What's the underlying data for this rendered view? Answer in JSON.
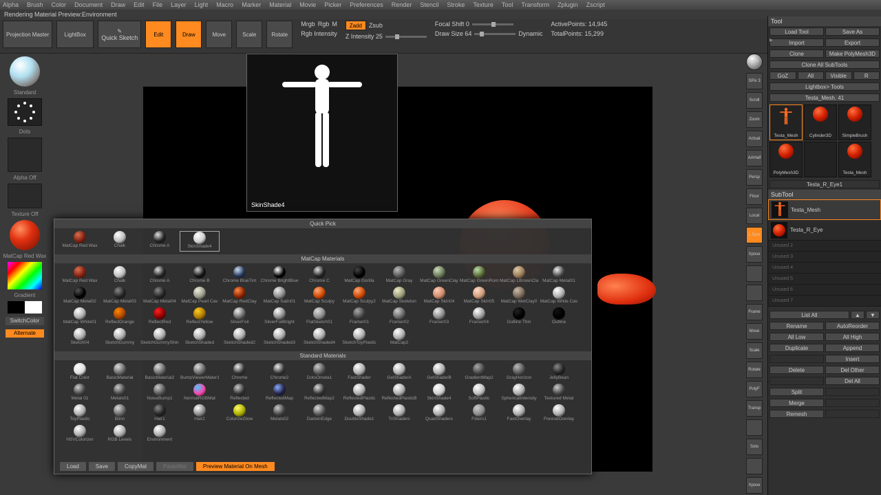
{
  "menu": [
    "Alpha",
    "Brush",
    "Color",
    "Document",
    "Draw",
    "Edit",
    "File",
    "Layer",
    "Light",
    "Macro",
    "Marker",
    "Material",
    "Movie",
    "Picker",
    "Preferences",
    "Render",
    "Stencil",
    "Stroke",
    "Texture",
    "Tool",
    "Transform",
    "Zplugin",
    "Zscript"
  ],
  "status": "Rendering Material Preview:Environment",
  "toolbar": {
    "projection": "Projection Master",
    "lightbox": "LightBox",
    "quicksketch": "Quick Sketch",
    "edit": "Edit",
    "draw": "Draw",
    "move": "Move",
    "scale": "Scale",
    "rotate": "Rotate",
    "mrgb": "Mrgb",
    "rgb": "Rgb",
    "m": "M",
    "zadd": "Zadd",
    "zsub": "Zsub",
    "rgb_int": "Rgb Intensity",
    "zint": "Z Intensity 25",
    "focal": "Focal Shift 0",
    "drawsize": "Draw Size 64",
    "dynamic": "Dynamic",
    "active": "ActivePoints: 14,945",
    "total": "TotalPoints: 15,299"
  },
  "left": {
    "brush": "Standard",
    "stroke": "Dots",
    "alpha": "Alpha Off",
    "texture": "Texture Off",
    "material": "MatCap Red Wax",
    "gradient": "Gradient",
    "switch": "SwitchColor",
    "alternate": "Alternate"
  },
  "preview_label": "SkinShade4",
  "right_icons": [
    "BPR",
    "SPix 3",
    "Scroll",
    "Zoom",
    "Actual",
    "AAHalf",
    "Persp",
    "Floor",
    "Local",
    "L.Sym",
    "Xpose",
    "",
    "",
    "Frame",
    "Move",
    "Scale",
    "Rotate",
    "PolyF",
    "Transp",
    "",
    "Solo",
    "",
    "Xpose"
  ],
  "tool": {
    "title": "Tool",
    "rows": [
      [
        "Load Tool",
        "Save As"
      ],
      [
        "Import",
        "Export"
      ],
      [
        "Clone",
        "Make PolyMesh3D"
      ],
      [
        "Clone All SubTools"
      ],
      [
        "GoZ",
        "All",
        "Visible",
        "R"
      ],
      [
        "Lightbox> Tools"
      ]
    ],
    "current": "Testa_Mesh. 41",
    "thumbs": [
      {
        "name": "Testa_Mesh",
        "kind": "figure",
        "active": true
      },
      {
        "name": "Cylinder3D",
        "kind": "sphere"
      },
      {
        "name": "SimpleBrush",
        "kind": "sphere"
      },
      {
        "name": "PolyMesh3D",
        "kind": "sphere"
      },
      {
        "name": "",
        "kind": "empty"
      },
      {
        "name": "Testa_Mesh",
        "kind": "sphere"
      }
    ],
    "subtool_hdr": "SubTool",
    "subtool_item": "Testa_R_Eye1",
    "subtools": [
      {
        "name": "Testa_Mesh",
        "kind": "figure"
      },
      {
        "name": "Testa_R_Eye",
        "kind": "sphere"
      }
    ],
    "unused": [
      "Unused 2",
      "Unused 3",
      "Unused 4",
      "Unused 5",
      "Unused 6",
      "Unused 7"
    ],
    "listall": "List All",
    "btns": [
      [
        "Rename",
        "AutoReorder"
      ],
      [
        "All Low",
        "All High"
      ],
      [
        "Duplicate",
        "Append"
      ],
      [
        "",
        "Insert"
      ],
      [
        "Delete",
        "Del Other"
      ],
      [
        "",
        "Del All"
      ],
      [
        "Split",
        ""
      ],
      [
        "Merge",
        ""
      ],
      [
        "Remesh",
        ""
      ]
    ]
  },
  "matpicker": {
    "quickpick_title": "Quick Pick",
    "quickpick": [
      {
        "name": "MatCap Red Wax",
        "c1": "#d87050",
        "c2": "#802010"
      },
      {
        "name": "Chalk",
        "c1": "#ffffff",
        "c2": "#bbbbbb"
      },
      {
        "name": "Chrome A",
        "c1": "#e0e0e0",
        "c2": "#222"
      },
      {
        "name": "SkinShade4",
        "c1": "#ffffff",
        "c2": "#cccccc",
        "sel": true
      }
    ],
    "matcap_title": "MatCap Materials",
    "matcap": [
      {
        "name": "MatCap Red Wax",
        "c1": "#d87050",
        "c2": "#802010"
      },
      {
        "name": "Chalk",
        "c1": "#fff",
        "c2": "#bbb"
      },
      {
        "name": "Chrome A",
        "c1": "#ddd",
        "c2": "#222"
      },
      {
        "name": "Chrome B",
        "c1": "#ccc",
        "c2": "#111"
      },
      {
        "name": "Chrome BlueTint",
        "c1": "#cde",
        "c2": "#235"
      },
      {
        "name": "Chrome BrightBlue",
        "c1": "#fff",
        "c2": "#000"
      },
      {
        "name": "Chrome C",
        "c1": "#ddd",
        "c2": "#222"
      },
      {
        "name": "MatCap Gorilla",
        "c1": "#444",
        "c2": "#000"
      },
      {
        "name": "MatCap Gray",
        "c1": "#bbb",
        "c2": "#555"
      },
      {
        "name": "MatCap GreenClay",
        "c1": "#cdb",
        "c2": "#675"
      },
      {
        "name": "MatCap GreenRom",
        "c1": "#bda",
        "c2": "#563"
      },
      {
        "name": "MatCap LBrownCla",
        "c1": "#dca",
        "c2": "#975"
      },
      {
        "name": "MatCap Metal01",
        "c1": "#eee",
        "c2": "#444"
      },
      {
        "name": "MatCap Metal02",
        "c1": "#555",
        "c2": "#000"
      },
      {
        "name": "MatCap Metal03",
        "c1": "#888",
        "c2": "#222"
      },
      {
        "name": "MatCap Metal04",
        "c1": "#888",
        "c2": "#222"
      },
      {
        "name": "MatCap Pearl Cav",
        "c1": "#eed",
        "c2": "#998"
      },
      {
        "name": "MatCap RedClay",
        "c1": "#f84",
        "c2": "#820"
      },
      {
        "name": "MatCap Satin01",
        "c1": "#eee",
        "c2": "#888"
      },
      {
        "name": "MatCap Sculpy",
        "c1": "#fa7",
        "c2": "#c40"
      },
      {
        "name": "MatCap Sculpy2",
        "c1": "#fa7",
        "c2": "#c40"
      },
      {
        "name": "MatCap Skeleton",
        "c1": "#eec",
        "c2": "#997"
      },
      {
        "name": "MatCap Skin04",
        "c1": "#fcb",
        "c2": "#c86"
      },
      {
        "name": "MatCap Skin05",
        "c1": "#fdc",
        "c2": "#c97"
      },
      {
        "name": "MatCap WetClay0",
        "c1": "#cba",
        "c2": "#765"
      },
      {
        "name": "MatCap White Cav",
        "c1": "#fff",
        "c2": "#aaa"
      },
      {
        "name": "MatCap White01",
        "c1": "#fff",
        "c2": "#aaa"
      },
      {
        "name": "ReflectOrange",
        "c1": "#f80",
        "c2": "#a40"
      },
      {
        "name": "ReflectRed",
        "c1": "#f22",
        "c2": "#800"
      },
      {
        "name": "ReflectYellow",
        "c1": "#fc2",
        "c2": "#a70"
      },
      {
        "name": "SilverFoil",
        "c1": "#eee",
        "c2": "#666"
      },
      {
        "name": "SilverFoilBright",
        "c1": "#fff",
        "c2": "#888"
      },
      {
        "name": "FlatSketch01",
        "c1": "#ddd",
        "c2": "#888"
      },
      {
        "name": "Framer01",
        "c1": "#aaa",
        "c2": "#444"
      },
      {
        "name": "Framer02",
        "c1": "#ccc",
        "c2": "#666"
      },
      {
        "name": "Framer03",
        "c1": "#eee",
        "c2": "#888"
      },
      {
        "name": "Framer04",
        "c1": "#fff",
        "c2": "#999"
      },
      {
        "name": "Outline Thin",
        "c1": "#222",
        "c2": "#000"
      },
      {
        "name": "Outline",
        "c1": "#111",
        "c2": "#000"
      },
      {
        "name": "Sketch04",
        "c1": "#fff",
        "c2": "#aaa"
      },
      {
        "name": "SketchGummy",
        "c1": "#fff",
        "c2": "#aaa"
      },
      {
        "name": "SketchGummyShine",
        "c1": "#fff",
        "c2": "#aaa"
      },
      {
        "name": "SketchShaded",
        "c1": "#fff",
        "c2": "#aaa"
      },
      {
        "name": "SketchShaded2",
        "c1": "#fff",
        "c2": "#aaa"
      },
      {
        "name": "SketchShaded3",
        "c1": "#fff",
        "c2": "#aaa"
      },
      {
        "name": "SketchShaded4",
        "c1": "#fff",
        "c2": "#aaa"
      },
      {
        "name": "SketchToyPlastic",
        "c1": "#fff",
        "c2": "#aaa"
      },
      {
        "name": "MatCap2",
        "c1": "#fff",
        "c2": "#aaa"
      }
    ],
    "standard_title": "Standard Materials",
    "standard": [
      {
        "name": "Flat Color",
        "c1": "#fff",
        "c2": "#ddd"
      },
      {
        "name": "BasicMaterial",
        "c1": "#ddd",
        "c2": "#666"
      },
      {
        "name": "BasicMaterial2",
        "c1": "#ddd",
        "c2": "#666"
      },
      {
        "name": "BumpViewerMater1",
        "c1": "#ddd",
        "c2": "#666"
      },
      {
        "name": "Chrome",
        "c1": "#eee",
        "c2": "#333"
      },
      {
        "name": "Chrome2",
        "c1": "#eee",
        "c2": "#333"
      },
      {
        "name": "DotsOmeta1",
        "c1": "#ccc",
        "c2": "#555"
      },
      {
        "name": "FastShader",
        "c1": "#fff",
        "c2": "#aaa"
      },
      {
        "name": "GelShaderA",
        "c1": "#fff",
        "c2": "#aaa"
      },
      {
        "name": "GelShaderB",
        "c1": "#fff",
        "c2": "#aaa"
      },
      {
        "name": "GradientMap2",
        "c1": "#aaa",
        "c2": "#444"
      },
      {
        "name": "GrayHorizon",
        "c1": "#bbb",
        "c2": "#555"
      },
      {
        "name": "JellyBean",
        "c1": "#888",
        "c2": "#222"
      },
      {
        "name": "Metal 01",
        "c1": "#ccc",
        "c2": "#444"
      },
      {
        "name": "Metals01",
        "c1": "#ccc",
        "c2": "#444"
      },
      {
        "name": "NoiseBump1",
        "c1": "#ccc",
        "c2": "#555"
      },
      {
        "name": "NormalRGBMat",
        "c1": "#4cf",
        "c2": "#f4a"
      },
      {
        "name": "Reflected",
        "c1": "#ccc",
        "c2": "#333"
      },
      {
        "name": "ReflectedMap",
        "c1": "#8af",
        "c2": "#224"
      },
      {
        "name": "ReflectedMap2",
        "c1": "#ddd",
        "c2": "#333"
      },
      {
        "name": "ReflectedPlastic",
        "c1": "#fff",
        "c2": "#aaa"
      },
      {
        "name": "ReflectedPlasticB",
        "c1": "#fff",
        "c2": "#aaa"
      },
      {
        "name": "SkinShade4",
        "c1": "#fff",
        "c2": "#ccc"
      },
      {
        "name": "SoftPlastic",
        "c1": "#fff",
        "c2": "#bbb"
      },
      {
        "name": "SphericalIntensity",
        "c1": "#fff",
        "c2": "#aaa"
      },
      {
        "name": "Textured Metal",
        "c1": "#ccc",
        "c2": "#444"
      },
      {
        "name": "ToyPlastic",
        "c1": "#fff",
        "c2": "#aaa"
      },
      {
        "name": "Blinn",
        "c1": "#ddd",
        "c2": "#666"
      },
      {
        "name": "Hair1",
        "c1": "#888",
        "c2": "#222"
      },
      {
        "name": "Hair2",
        "c1": "#fff",
        "c2": "#888"
      },
      {
        "name": "ColorizeGlow",
        "c1": "#ff6",
        "c2": "#aa0"
      },
      {
        "name": "Metals02",
        "c1": "#ccc",
        "c2": "#444"
      },
      {
        "name": "DarkenEdge",
        "c1": "#ddd",
        "c2": "#555"
      },
      {
        "name": "DoubleShade1",
        "c1": "#fff",
        "c2": "#aaa"
      },
      {
        "name": "TriShaders",
        "c1": "#fff",
        "c2": "#aaa"
      },
      {
        "name": "QuadShaders",
        "c1": "#fff",
        "c2": "#aaa"
      },
      {
        "name": "Fibers1",
        "c1": "#ccc",
        "c2": "#888"
      },
      {
        "name": "FastOverlay",
        "c1": "#fff",
        "c2": "#aaa"
      },
      {
        "name": "FresnelOverlay",
        "c1": "#fff",
        "c2": "#aaa"
      },
      {
        "name": "HSVColorizer",
        "c1": "#fff",
        "c2": "#aaa"
      },
      {
        "name": "RGB Levels",
        "c1": "#fff",
        "c2": "#aaa"
      },
      {
        "name": "Environment",
        "c1": "#fff",
        "c2": "#aaa"
      }
    ],
    "footer": {
      "load": "Load",
      "save": "Save",
      "copy": "CopyMat",
      "paste": "PasteMat",
      "preview": "Preview Material On Mesh"
    }
  }
}
